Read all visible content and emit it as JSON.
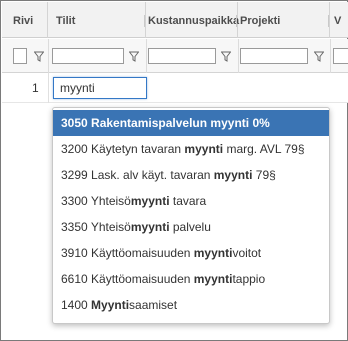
{
  "columns": {
    "rivi": "Rivi",
    "tilit": "Tilit",
    "kustannuspaikka": "Kustannuspaikka",
    "projekti": "Projekti",
    "v": "V"
  },
  "row": {
    "number": "1",
    "input_value": "myynti"
  },
  "dropdown": {
    "options": [
      {
        "pre": "3050 Rakentamispalvelun ",
        "match": "myynti",
        "post": " 0%",
        "selected": true
      },
      {
        "pre": "3200 Käytetyn tavaran ",
        "match": "myynti",
        "post": " marg. AVL 79§",
        "selected": false
      },
      {
        "pre": "3299 Lask. alv käyt. tavaran ",
        "match": "myynti",
        "post": " 79§",
        "selected": false
      },
      {
        "pre": "3300 Yhteisö",
        "match": "myynti",
        "post": " tavara",
        "selected": false
      },
      {
        "pre": "3350 Yhteisö",
        "match": "myynti",
        "post": " palvelu",
        "selected": false
      },
      {
        "pre": "3910 Käyttöomaisuuden ",
        "match": "myynti",
        "post": "voitot",
        "selected": false
      },
      {
        "pre": "6610 Käyttöomaisuuden ",
        "match": "myynti",
        "post": "tappio",
        "selected": false
      },
      {
        "pre": "1400 ",
        "match": "Myynti",
        "post": "saamiset",
        "selected": false
      }
    ]
  },
  "colors": {
    "accent": "#3a74b4",
    "focus_border": "#3478c6",
    "header_bg": "#f2f2f2"
  },
  "icons": {
    "filter": "funnel-icon"
  }
}
